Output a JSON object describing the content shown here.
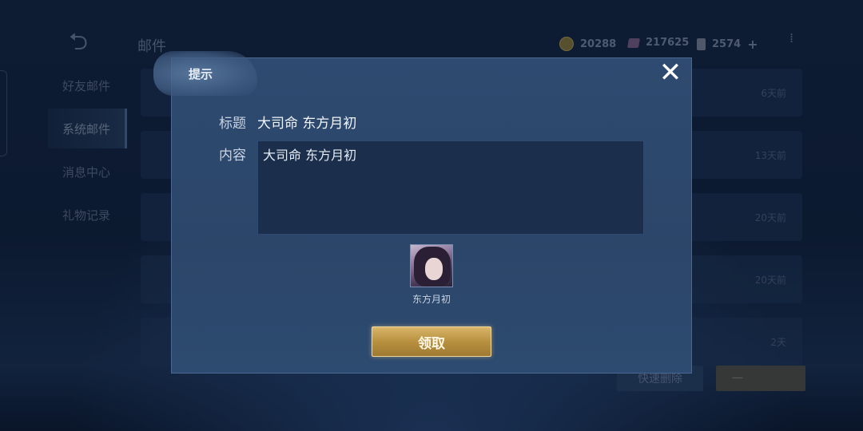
{
  "topbar": {
    "title": "邮件",
    "gold": "20288",
    "gems": "217625",
    "tickets": "2574"
  },
  "sidebar": {
    "items": [
      {
        "label": "好友邮件",
        "active": false
      },
      {
        "label": "系统邮件",
        "active": true
      },
      {
        "label": "消息中心",
        "active": false
      },
      {
        "label": "礼物记录",
        "active": false
      }
    ]
  },
  "mail_list": {
    "times": [
      "6天前",
      "13天前",
      "20天前",
      "20天前",
      "2天"
    ],
    "quick_delete": "快速删除",
    "one_key": "一"
  },
  "modal": {
    "title": "提示",
    "subject_label": "标题",
    "subject_value": "大司命 东方月初",
    "content_label": "内容",
    "content_value": "大司命 东方月初",
    "reward_name": "东方月初",
    "claim_button": "领取"
  },
  "colors": {
    "modal_bg": "#2e4a70",
    "claim_gold": "#c9a252"
  }
}
